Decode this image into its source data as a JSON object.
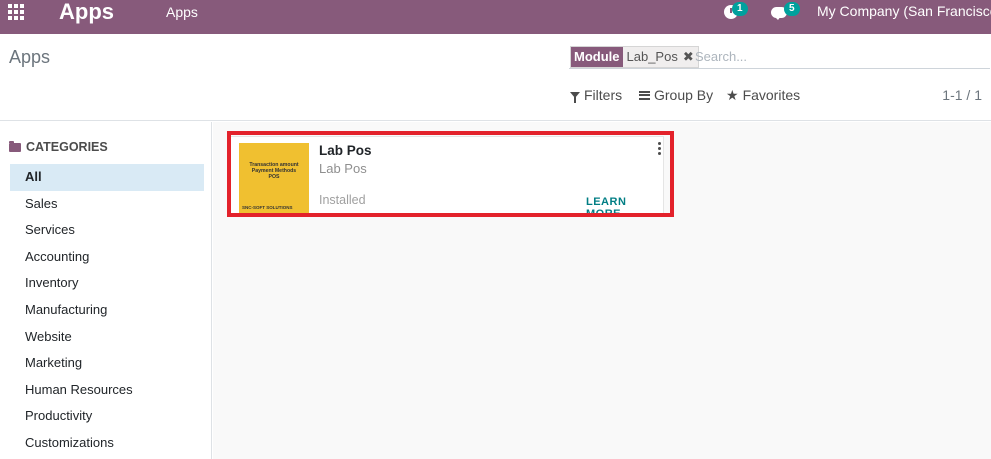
{
  "navbar": {
    "brand": "Apps",
    "menu_item": "Apps",
    "activity_count": "1",
    "messages_count": "5",
    "company": "My Company (San Francisco)"
  },
  "control_panel": {
    "breadcrumb": "Apps",
    "search": {
      "facet_label": "Module",
      "facet_value": "Lab_Pos",
      "placeholder": "Search..."
    },
    "filters_label": "Filters",
    "groupby_label": "Group By",
    "favorites_label": "Favorites",
    "pager": "1-1 / 1"
  },
  "sidebar": {
    "header": "CATEGORIES",
    "items": [
      {
        "label": "All",
        "active": true
      },
      {
        "label": "Sales"
      },
      {
        "label": "Services"
      },
      {
        "label": "Accounting"
      },
      {
        "label": "Inventory"
      },
      {
        "label": "Manufacturing"
      },
      {
        "label": "Website"
      },
      {
        "label": "Marketing"
      },
      {
        "label": "Human Resources"
      },
      {
        "label": "Productivity"
      },
      {
        "label": "Customizations"
      }
    ]
  },
  "app_card": {
    "name": "Lab Pos",
    "technical_name": "Lab Pos",
    "status": "Installed",
    "action": "LEARN MORE",
    "thumbnail": {
      "line1": "Transaction amount",
      "line2": "Payment Methods",
      "line3": "POS",
      "footer": "SNC-SOFT SOLUTIONS",
      "background": "#f0c030"
    }
  },
  "colors": {
    "brand": "#875a7b",
    "badge": "#00a09d",
    "highlight": "#e3222b",
    "link": "#017e84"
  }
}
